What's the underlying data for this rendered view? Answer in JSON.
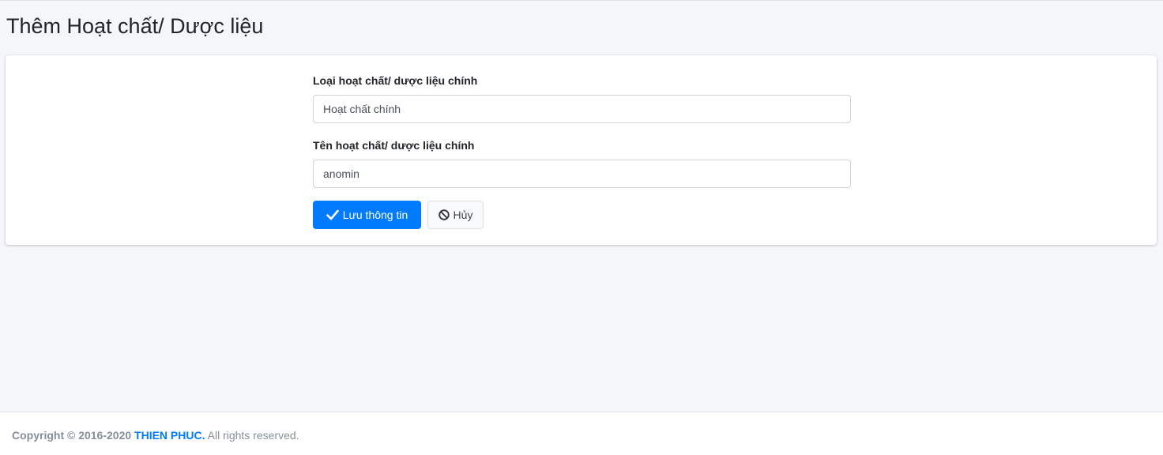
{
  "page": {
    "title": "Thêm Hoạt chất/ Dược liệu"
  },
  "form": {
    "field_type": {
      "label": "Loại hoạt chất/ dược liệu chính",
      "value": "Hoạt chất chính"
    },
    "field_name": {
      "label": "Tên hoạt chất/ dược liệu chính",
      "value": "anomin"
    },
    "save_button": {
      "label": "Lưu thông tin",
      "icon": "check-icon"
    },
    "cancel_button": {
      "label": "Hủy",
      "icon": "ban-icon"
    }
  },
  "footer": {
    "copyright": "Copyright © 2016-2020",
    "company": "THIEN PHUC.",
    "rights": "All rights reserved."
  },
  "colors": {
    "primary": "#007bff",
    "background": "#f4f6f9",
    "footer_text": "#869099"
  }
}
